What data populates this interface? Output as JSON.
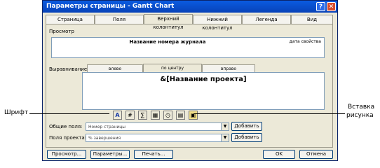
{
  "dialog": {
    "title": "Параметры страницы - Gantt Chart",
    "help": "?",
    "close": "✕"
  },
  "tabs": [
    "Страница",
    "Поля",
    "Верхний колонтитул",
    "Нижний колонтитул",
    "Легенда",
    "Вид"
  ],
  "preview": {
    "label": "Просмотр",
    "center_text": "Название номера журнала",
    "right_text": "дата свойства"
  },
  "alignment": {
    "label": "Выравнивание:",
    "tabs": [
      "влево",
      "по центру",
      "вправо"
    ]
  },
  "editor": {
    "text": "&[Название проекта]"
  },
  "toolbar": {
    "buttons": [
      "A",
      "#",
      "∑",
      "▦",
      "◷",
      "▤",
      "▣"
    ]
  },
  "fields": {
    "general_label": "Общие поля:",
    "general_value": "Номер страницы",
    "project_label": "Поля проекта:",
    "project_value": "% завершения",
    "add_label": "Добавить"
  },
  "footer": {
    "preview_btn": "Просмотр...",
    "options_btn": "Параметры...",
    "print_btn": "Печать...",
    "ok_btn": "OK",
    "cancel_btn": "Отмена"
  },
  "callouts": {
    "left": "Шрифт",
    "right_line1": "Вставка",
    "right_line2": "рисунка"
  },
  "colors": {
    "titlebar": "#0a5be0",
    "dialog_bg": "#ece9d8",
    "editor_bg": "#ffffff"
  }
}
